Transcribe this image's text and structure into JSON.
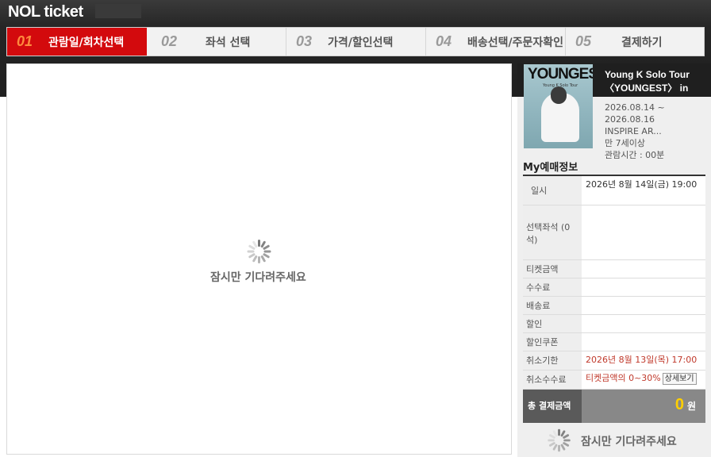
{
  "header": {
    "brand": "NOL ticket"
  },
  "steps": [
    {
      "num": "01",
      "label": "관람일/회차선택",
      "active": true
    },
    {
      "num": "02",
      "label": "좌석 선택",
      "active": false
    },
    {
      "num": "03",
      "label": "가격/할인선택",
      "active": false
    },
    {
      "num": "04",
      "label": "배송선택/주문자확인",
      "active": false
    },
    {
      "num": "05",
      "label": "결제하기",
      "active": false
    }
  ],
  "main": {
    "loading_text": "잠시만 기다려주세요"
  },
  "show": {
    "poster_title": "YOUNGEST",
    "poster_subtitle": "Young K Solo Tour",
    "title": "Young K Solo Tour 〈YOUNGEST〉 in",
    "date_range": "2026.08.14 ~ 2026.08.16",
    "venue": "INSPIRE AR...",
    "age": "만 7세이상",
    "runtime": "관람시간 : 00분"
  },
  "my_booking": {
    "title": "My예매정보",
    "rows": [
      {
        "label": "일시",
        "value": "2026년 8월 14일(금) 19:00"
      },
      {
        "label": "선택좌석 (0석)",
        "value": ""
      },
      {
        "label": "티켓금액",
        "value": ""
      },
      {
        "label": "수수료",
        "value": ""
      },
      {
        "label": "배송료",
        "value": ""
      },
      {
        "label": "할인",
        "value": ""
      },
      {
        "label": "할인쿠폰",
        "value": ""
      },
      {
        "label": "취소기한",
        "value": "2026년 8월 13일(목) 17:00"
      },
      {
        "label": "취소수수료",
        "value": "티켓금액의 0~30%"
      }
    ],
    "detail_button": "상세보기",
    "total_label": "총 결제금액",
    "total_amount": "0",
    "total_unit": "원"
  },
  "side_loading_text": "잠시만 기다려주세요",
  "colors": {
    "accent": "#d30a0d",
    "step_num_active": "#ff8a3d",
    "total_amount": "#ffcf00",
    "cancel_text": "#c0392b"
  },
  "icons": {
    "spinner": "loading-spinner-icon"
  }
}
